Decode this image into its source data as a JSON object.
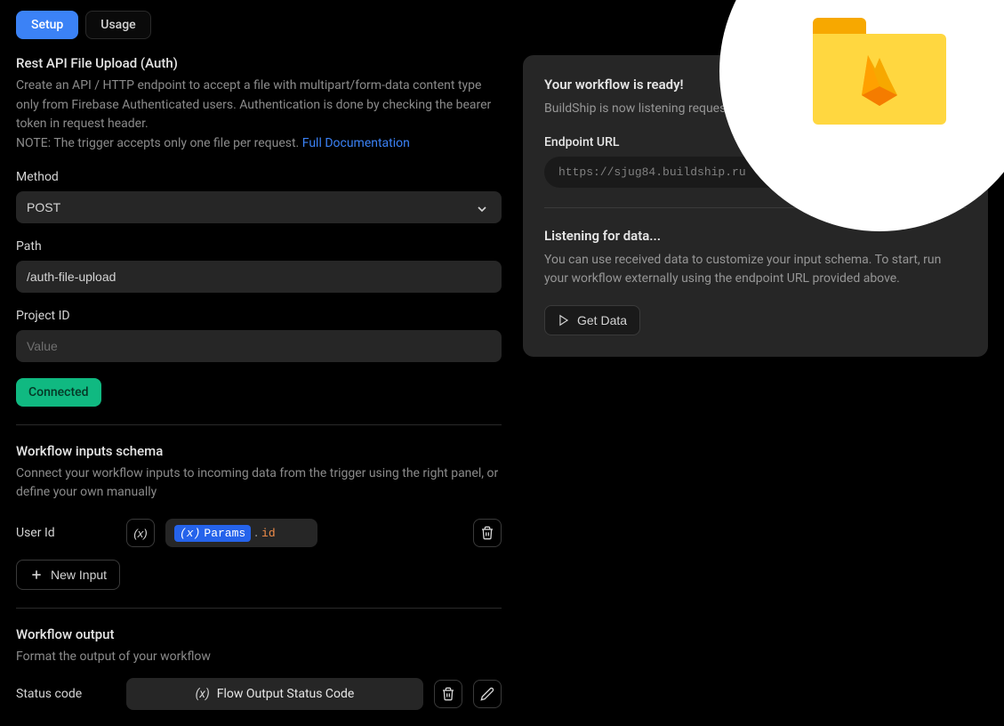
{
  "tabs": {
    "setup": "Setup",
    "usage": "Usage"
  },
  "header": {
    "title": "Rest API File Upload (Auth)",
    "desc_line1": "Create an API / HTTP endpoint to accept a file with multipart/form-data content type only from Firebase Authenticated users. Authentication is done by checking the bearer token in request header.",
    "desc_line2": "NOTE: The trigger accepts only one file per request. ",
    "doc_link": "Full Documentation"
  },
  "form": {
    "method_label": "Method",
    "method_value": "POST",
    "path_label": "Path",
    "path_value": "/auth-file-upload",
    "project_id_label": "Project ID",
    "project_id_placeholder": "Value",
    "connected_label": "Connected"
  },
  "inputs_schema": {
    "title": "Workflow inputs schema",
    "desc": "Connect your workflow inputs to incoming data from the trigger using the right panel, or define your own manually",
    "user_id_label": "User Id",
    "param_chip": "Params",
    "param_prop": "id",
    "new_input_label": "New Input"
  },
  "output": {
    "title": "Workflow output",
    "desc": "Format the output of your workflow",
    "status_label": "Status code",
    "status_expr": "Flow Output Status Code"
  },
  "right": {
    "ready_title": "Your workflow is ready!",
    "ready_desc": "BuildShip is now listening requests to the endpoint U",
    "url_label": "Endpoint URL",
    "url_value": "https://sjug84.buildship.ru",
    "listening_title": "Listening for data...",
    "listening_desc": "You can use received data to customize your input schema. To start, run your workflow externally using the endpoint URL provided above.",
    "get_data": "Get Data"
  }
}
